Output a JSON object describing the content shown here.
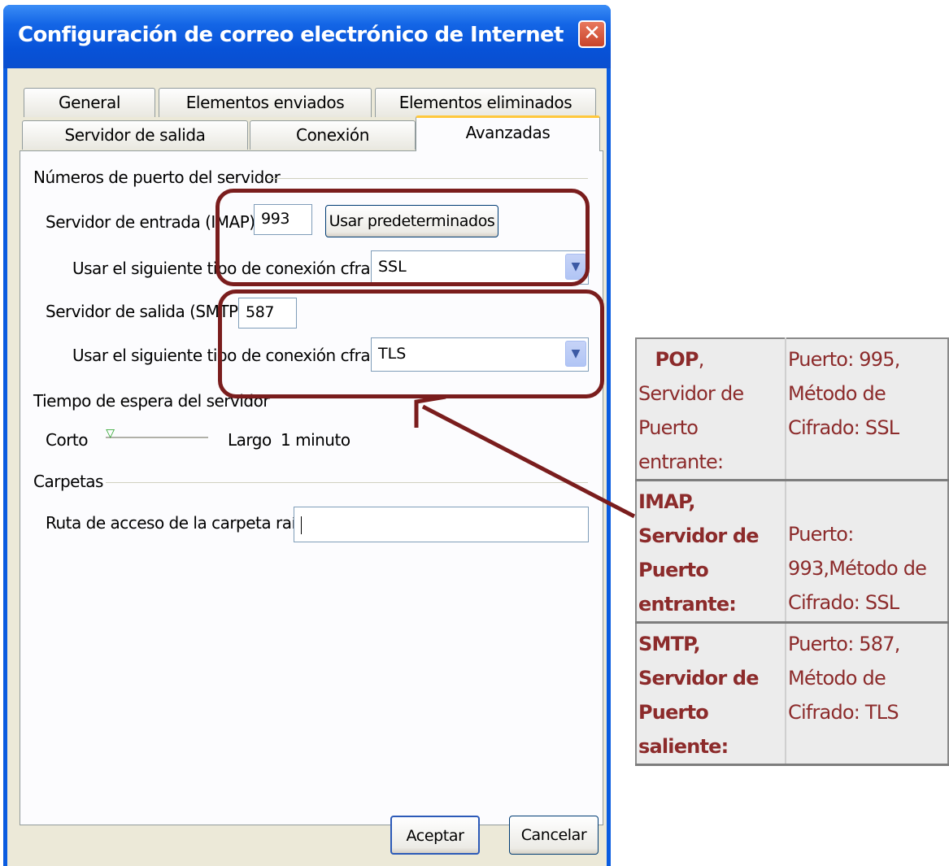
{
  "window": {
    "title": "Configuración de correo electrónico de Internet",
    "close_glyph": "✕"
  },
  "tabs": [
    {
      "label": "General"
    },
    {
      "label": "Elementos enviados"
    },
    {
      "label": "Elementos eliminados"
    },
    {
      "label": "Servidor de salida"
    },
    {
      "label": "Conexión"
    },
    {
      "label": "Avanzadas",
      "active": true
    }
  ],
  "ports": {
    "group_label": "Números de puerto del servidor",
    "incoming_label": "Servidor de entrada (IMAP):",
    "incoming_value": "993",
    "default_button": "Usar predeterminados",
    "encryption_label": "Usar el siguiente tipo de conexión cfrada:",
    "incoming_encryption": "SSL",
    "outgoing_label": "Servidor de salida (SMTP):",
    "outgoing_value": "587",
    "outgoing_encryption": "TLS"
  },
  "timeout": {
    "label": "Tiempo de espera del servidor",
    "short": "Corto",
    "long": "Largo",
    "value": "1 minuto",
    "level": 0.05
  },
  "folders": {
    "group_label": "Carpetas",
    "root_label": "Ruta de acceso de la carpeta raíz:",
    "root_value": ""
  },
  "footer": {
    "ok": "Aceptar",
    "cancel": "Cancelar"
  },
  "info_table": {
    "rows": [
      {
        "bold": "POP",
        "rest": ", Servidor de Puerto entrante:",
        "detail": "Puerto: 995, Método de Cifrado: SSL"
      },
      {
        "bold": "IMAP, Servidor de Puerto entrante:",
        "rest": "",
        "detail": "Puerto: 993,Método de Cifrado: SSL"
      },
      {
        "bold": "SMTP, Servidor de Puerto saliente:",
        "rest": "",
        "detail": "Puerto: 587, Método de Cifrado: TLS"
      }
    ]
  },
  "icons": {
    "dropdown": "chevron-down-icon",
    "thumb": "slider-thumb-icon",
    "arrow": "callout-arrow"
  },
  "colors": {
    "highlight": "#7a1d1d",
    "table_text": "#8c2b2b",
    "title_bar": "#0a5ce0"
  }
}
